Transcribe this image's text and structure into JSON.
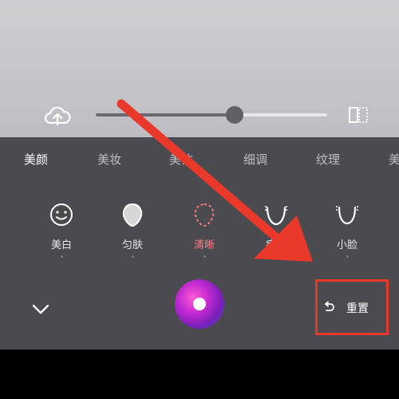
{
  "tabs": [
    {
      "label": "美颜",
      "active": true
    },
    {
      "label": "美妆",
      "active": false
    },
    {
      "label": "美体",
      "active": false
    },
    {
      "label": "细调",
      "active": false
    },
    {
      "label": "纹理",
      "active": false
    },
    {
      "label": "美",
      "active": false
    }
  ],
  "slider": {
    "value": 0.6
  },
  "tools": [
    {
      "label": "美白",
      "icon": "face-smile-icon",
      "active": false
    },
    {
      "label": "匀肤",
      "icon": "egg-shape-icon",
      "active": false
    },
    {
      "label": "清晰",
      "icon": "dotted-circle-icon",
      "active": true
    },
    {
      "label": "瘦脸",
      "icon": "chin-shape-icon",
      "active": false
    },
    {
      "label": "小脸",
      "icon": "chin-shape-icon",
      "active": false
    }
  ],
  "actions": {
    "reset_label": "重置"
  },
  "colors": {
    "accent": "#ff7b8a",
    "annotation": "#e8392b",
    "panel": "#4b4b4f"
  }
}
